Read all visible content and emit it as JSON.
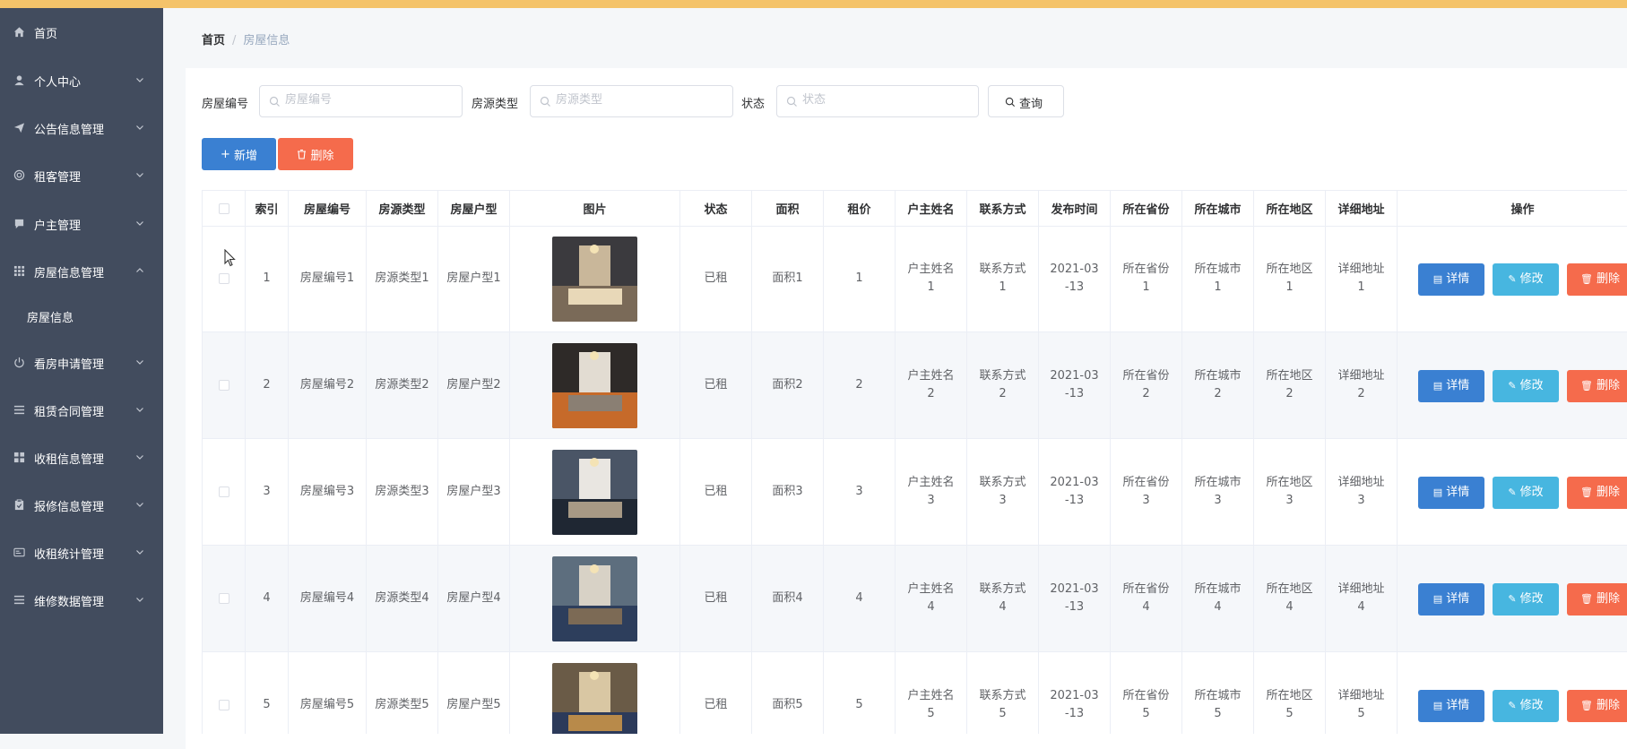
{
  "colors": {
    "sidebar": "#424c5e",
    "topbar": "#f4c36a",
    "primary": "#3a80d2",
    "info": "#47b6e0",
    "danger": "#f56b4c"
  },
  "sidebar": {
    "items": [
      {
        "label": "首页",
        "icon": "home-icon",
        "expandable": false
      },
      {
        "label": "个人中心",
        "icon": "user-icon",
        "expandable": true
      },
      {
        "label": "公告信息管理",
        "icon": "send-icon",
        "expandable": true
      },
      {
        "label": "租客管理",
        "icon": "target-icon",
        "expandable": true
      },
      {
        "label": "户主管理",
        "icon": "chat-icon",
        "expandable": true
      },
      {
        "label": "房屋信息管理",
        "icon": "grid-icon",
        "expandable": true,
        "expanded": true
      },
      {
        "label": "看房申请管理",
        "icon": "power-icon",
        "expandable": true
      },
      {
        "label": "租赁合同管理",
        "icon": "list-icon",
        "expandable": true
      },
      {
        "label": "收租信息管理",
        "icon": "apps-icon",
        "expandable": true
      },
      {
        "label": "报修信息管理",
        "icon": "clipboard-icon",
        "expandable": true
      },
      {
        "label": "收租统计管理",
        "icon": "card-icon",
        "expandable": true
      },
      {
        "label": "维修数据管理",
        "icon": "list-icon",
        "expandable": true
      }
    ],
    "sub_item": "房屋信息"
  },
  "breadcrumb": {
    "home": "首页",
    "separator": "/",
    "current": "房屋信息"
  },
  "search": {
    "house_no_label": "房屋编号",
    "house_no_placeholder": "房屋编号",
    "type_label": "房源类型",
    "type_placeholder": "房源类型",
    "status_label": "状态",
    "status_placeholder": "状态",
    "query_label": "查询"
  },
  "toolbar": {
    "add_label": "新增",
    "delete_label": "删除"
  },
  "table": {
    "headers": [
      "索引",
      "房屋编号",
      "房源类型",
      "房屋户型",
      "图片",
      "状态",
      "面积",
      "租价",
      "户主姓名",
      "联系方式",
      "发布时间",
      "所在省份",
      "所在城市",
      "所在地区",
      "详细地址",
      "操作"
    ],
    "rows": [
      {
        "index": "1",
        "house_no": "房屋编号1",
        "type": "房源类型1",
        "layout": "房屋户型1",
        "status": "已租",
        "area": "面积1",
        "price": "1",
        "owner": "户主姓名1",
        "contact": "联系方式1",
        "date": "2021-03-13",
        "province": "所在省份1",
        "city": "所在城市1",
        "district": "所在地区1",
        "address": "详细地址1"
      },
      {
        "index": "2",
        "house_no": "房屋编号2",
        "type": "房源类型2",
        "layout": "房屋户型2",
        "status": "已租",
        "area": "面积2",
        "price": "2",
        "owner": "户主姓名2",
        "contact": "联系方式2",
        "date": "2021-03-13",
        "province": "所在省份2",
        "city": "所在城市2",
        "district": "所在地区2",
        "address": "详细地址2"
      },
      {
        "index": "3",
        "house_no": "房屋编号3",
        "type": "房源类型3",
        "layout": "房屋户型3",
        "status": "已租",
        "area": "面积3",
        "price": "3",
        "owner": "户主姓名3",
        "contact": "联系方式3",
        "date": "2021-03-13",
        "province": "所在省份3",
        "city": "所在城市3",
        "district": "所在地区3",
        "address": "详细地址3"
      },
      {
        "index": "4",
        "house_no": "房屋编号4",
        "type": "房源类型4",
        "layout": "房屋户型4",
        "status": "已租",
        "area": "面积4",
        "price": "4",
        "owner": "户主姓名4",
        "contact": "联系方式4",
        "date": "2021-03-13",
        "province": "所在省份4",
        "city": "所在城市4",
        "district": "所在地区4",
        "address": "详细地址4"
      },
      {
        "index": "5",
        "house_no": "房屋编号5",
        "type": "房源类型5",
        "layout": "房屋户型5",
        "status": "已租",
        "area": "面积5",
        "price": "5",
        "owner": "户主姓名5",
        "contact": "联系方式5",
        "date": "2021-03-13",
        "province": "所在省份5",
        "city": "所在城市5",
        "district": "所在地区5",
        "address": "详细地址5"
      }
    ],
    "actions": {
      "detail": "详情",
      "edit": "修改",
      "delete": "删除"
    }
  }
}
